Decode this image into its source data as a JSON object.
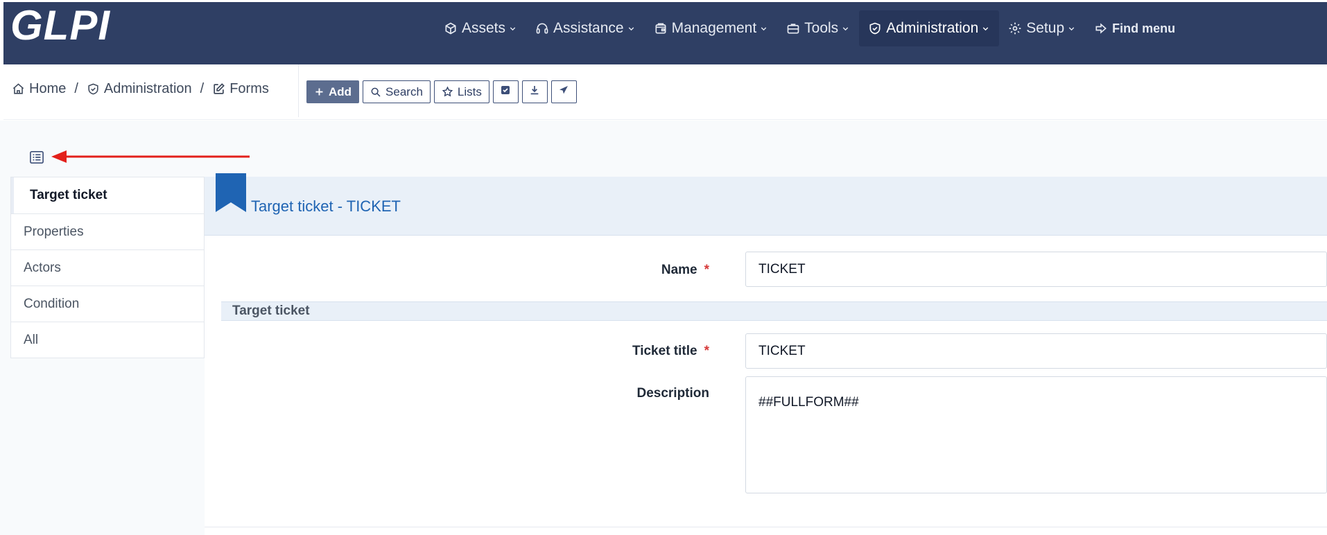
{
  "app": {
    "logo": "GLPI"
  },
  "nav": {
    "items": [
      {
        "label": "Assets",
        "icon": "box-icon"
      },
      {
        "label": "Assistance",
        "icon": "headset-icon"
      },
      {
        "label": "Management",
        "icon": "wallet-icon"
      },
      {
        "label": "Tools",
        "icon": "briefcase-icon"
      },
      {
        "label": "Administration",
        "icon": "shield-check-icon",
        "active": true
      },
      {
        "label": "Setup",
        "icon": "gear-icon"
      }
    ],
    "find_menu": "Find menu"
  },
  "breadcrumb": [
    {
      "label": "Home",
      "icon": "home-icon"
    },
    {
      "label": "Administration",
      "icon": "shield-check-icon"
    },
    {
      "label": "Forms",
      "icon": "edit-icon"
    }
  ],
  "actions": {
    "add": "Add",
    "search": "Search",
    "lists": "Lists"
  },
  "tabs": [
    {
      "label": "Target ticket",
      "active": true
    },
    {
      "label": "Properties"
    },
    {
      "label": "Actors"
    },
    {
      "label": "Condition"
    },
    {
      "label": "All"
    }
  ],
  "header": {
    "title": "Target ticket - TICKET"
  },
  "form": {
    "name": {
      "label": "Name",
      "value": "TICKET",
      "required": true
    },
    "section_title": "Target ticket",
    "ticket_title": {
      "label": "Ticket title",
      "value": "TICKET",
      "required": true
    },
    "description": {
      "label": "Description",
      "value": "##FULLFORM##"
    }
  },
  "colors": {
    "nav_bg": "#2f3f64",
    "accent_blue": "#1f64b3",
    "required_red": "#d63939",
    "arrow_red": "#e3201b"
  }
}
